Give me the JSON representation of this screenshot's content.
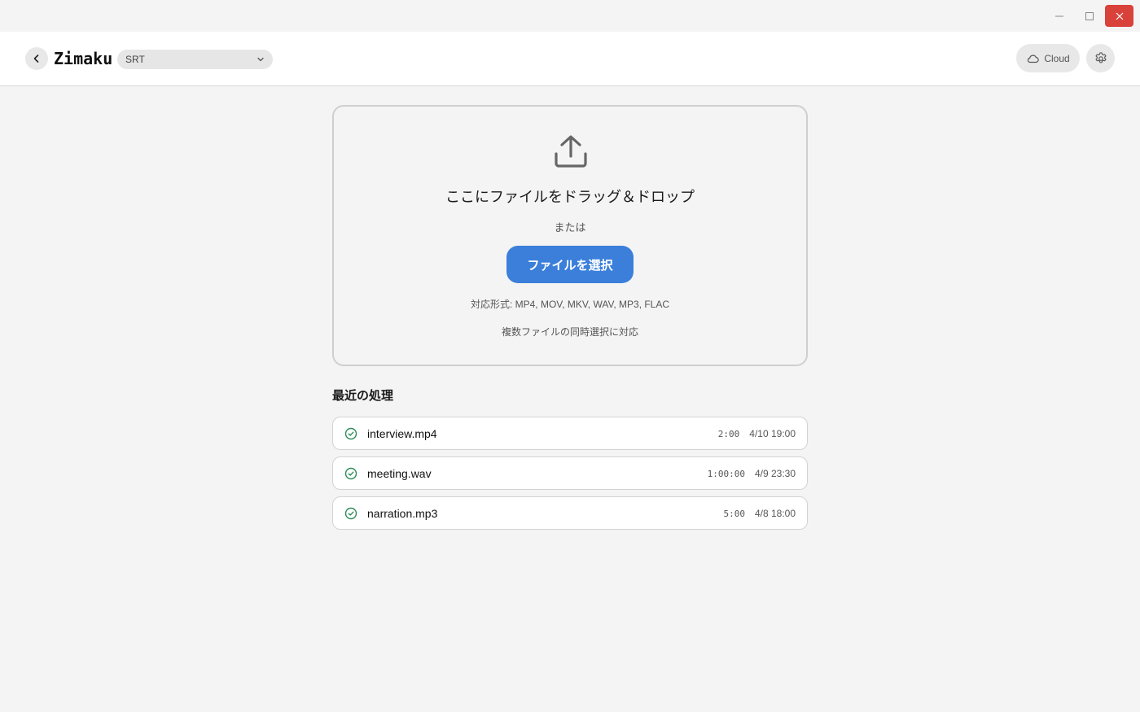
{
  "window": {
    "controls": {
      "minimize_icon": "minimize-icon",
      "maximize_icon": "maximize-icon",
      "close_icon": "close-icon",
      "close_color": "#d9413b"
    }
  },
  "header": {
    "app_title": "Zimaku",
    "format": "SRT",
    "cloud_label": "Cloud"
  },
  "dropzone": {
    "title": "ここにファイルをドラッグ＆ドロップ",
    "or_text": "または",
    "select_button": "ファイルを選択",
    "formats": "対応形式: MP4, MOV, MKV, WAV, MP3, FLAC",
    "multi_select": "複数ファイルの同時選択に対応"
  },
  "recent": {
    "title": "最近の処理",
    "items": [
      {
        "name": "interview.mp4",
        "duration": "2:00",
        "date": "4/10 19:00",
        "status": "completed"
      },
      {
        "name": "meeting.wav",
        "duration": "1:00:00",
        "date": "4/9 23:30",
        "status": "completed"
      },
      {
        "name": "narration.mp3",
        "duration": "5:00",
        "date": "4/8 18:00",
        "status": "completed"
      }
    ]
  },
  "colors": {
    "accent": "#3b7fdb",
    "success": "#2e8b57",
    "background": "#f4f4f4"
  }
}
